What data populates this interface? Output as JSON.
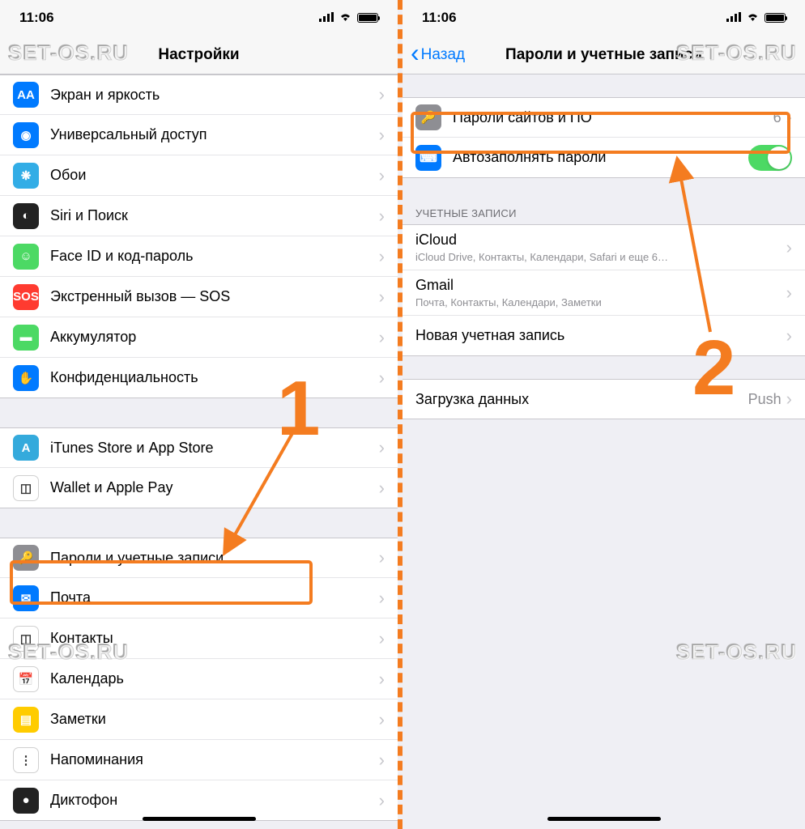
{
  "watermark": "SET-OS.RU",
  "status_time": "11:06",
  "annotations": {
    "step1": "1",
    "step2": "2"
  },
  "left": {
    "title": "Настройки",
    "group1": [
      {
        "icon": "AA",
        "bg": "bg-blue",
        "label": "Экран и яркость",
        "name": "display-brightness"
      },
      {
        "icon": "◉",
        "bg": "bg-blue",
        "label": "Универсальный доступ",
        "name": "accessibility"
      },
      {
        "icon": "❋",
        "bg": "bg-teal",
        "label": "Обои",
        "name": "wallpaper"
      },
      {
        "icon": "◐",
        "bg": "bg-dark",
        "label": "Siri и Поиск",
        "name": "siri-search"
      },
      {
        "icon": "☺",
        "bg": "bg-green",
        "label": "Face ID и код-пароль",
        "name": "faceid-passcode"
      },
      {
        "icon": "SOS",
        "bg": "bg-red",
        "label": "Экстренный вызов — SOS",
        "name": "emergency-sos"
      },
      {
        "icon": "▬",
        "bg": "bg-green",
        "label": "Аккумулятор",
        "name": "battery"
      },
      {
        "icon": "✋",
        "bg": "bg-blue",
        "label": "Конфиденциальность",
        "name": "privacy"
      }
    ],
    "group2": [
      {
        "icon": "A",
        "bg": "bg-lblue",
        "label": "iTunes Store и App Store",
        "name": "itunes-appstore"
      },
      {
        "icon": "◫",
        "bg": "bg-white2",
        "label": "Wallet и Apple Pay",
        "name": "wallet-applepay"
      }
    ],
    "group3": [
      {
        "icon": "🔑",
        "bg": "bg-gray",
        "label": "Пароли и учетные записи",
        "name": "passwords-accounts",
        "highlighted": true
      },
      {
        "icon": "✉",
        "bg": "bg-blue",
        "label": "Почта",
        "name": "mail"
      },
      {
        "icon": "◫",
        "bg": "bg-white2",
        "label": "Контакты",
        "name": "contacts"
      },
      {
        "icon": "📅",
        "bg": "bg-white2",
        "label": "Календарь",
        "name": "calendar"
      },
      {
        "icon": "▤",
        "bg": "bg-yellow",
        "label": "Заметки",
        "name": "notes"
      },
      {
        "icon": "⋮",
        "bg": "bg-white2",
        "label": "Напоминания",
        "name": "reminders"
      },
      {
        "icon": "●",
        "bg": "bg-dark",
        "label": "Диктофон",
        "name": "voice-memos"
      }
    ]
  },
  "right": {
    "back": "Назад",
    "title": "Пароли и учетные записи",
    "row_passwords": {
      "label": "Пароли сайтов и ПО",
      "count": "6"
    },
    "row_autofill": {
      "label": "Автозаполнять пароли"
    },
    "accounts_header": "УЧЕТНЫЕ ЗАПИСИ",
    "accounts": [
      {
        "title": "iCloud",
        "sub": "iCloud Drive, Контакты, Календари, Safari и еще 6…",
        "name": "account-icloud"
      },
      {
        "title": "Gmail",
        "sub": "Почта, Контакты, Календари, Заметки",
        "name": "account-gmail"
      },
      {
        "title": "Новая учетная запись",
        "sub": "",
        "name": "add-account"
      }
    ],
    "fetch": {
      "label": "Загрузка данных",
      "value": "Push"
    }
  }
}
